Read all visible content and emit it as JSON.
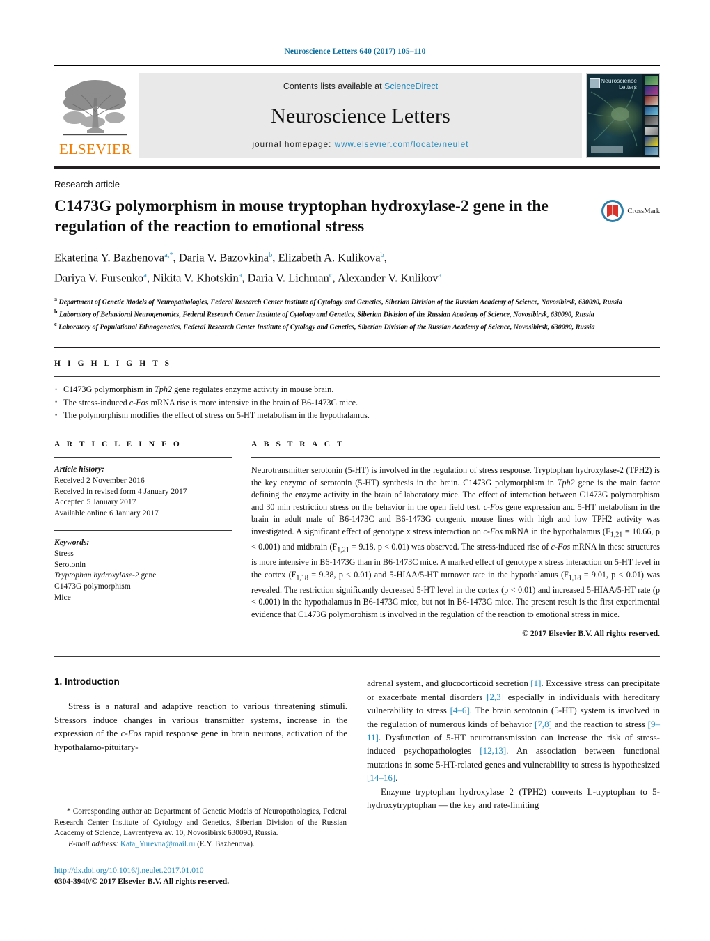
{
  "running_head": "Neuroscience Letters 640 (2017) 105–110",
  "banner": {
    "publisher": "ELSEVIER",
    "contents_prefix": "Contents lists available at ",
    "contents_link": "ScienceDirect",
    "journal_name": "Neuroscience Letters",
    "homepage_label": "journal homepage: ",
    "homepage_url": "www.elsevier.com/locate/neulet",
    "cover_title": "Neuroscience Letters"
  },
  "article": {
    "kicker": "Research article",
    "title": "C1473G polymorphism in mouse tryptophan hydroxylase-2 gene in the regulation of the reaction to emotional stress",
    "crossmark_label": "CrossMark",
    "authors_line1_parts": [
      {
        "name": "Ekaterina Y. Bazhenova",
        "sup": "a,",
        "star": "*"
      },
      {
        "name": "Daria V. Bazovkina",
        "sup": "b"
      },
      {
        "name": "Elizabeth A. Kulikova",
        "sup": "b"
      }
    ],
    "authors_line2_parts": [
      {
        "name": "Dariya V. Fursenko",
        "sup": "a"
      },
      {
        "name": "Nikita V. Khotskin",
        "sup": "a"
      },
      {
        "name": "Daria V. Lichman",
        "sup": "c"
      },
      {
        "name": "Alexander V. Kulikov",
        "sup": "a"
      }
    ],
    "affiliations": [
      {
        "mark": "a",
        "text": "Department of Genetic Models of Neuropathologies, Federal Research Center Institute of Cytology and Genetics, Siberian Division of the Russian Academy of Science, Novosibirsk, 630090, Russia"
      },
      {
        "mark": "b",
        "text": "Laboratory of Behavioral Neurogenomics, Federal Research Center Institute of Cytology and Genetics, Siberian Division of the Russian Academy of Science, Novosibirsk, 630090, Russia"
      },
      {
        "mark": "c",
        "text": "Laboratory of Populational Ethnogenetics, Federal Research Center Institute of Cytology and Genetics, Siberian Division of the Russian Academy of Science, Novosibirsk, 630090, Russia"
      }
    ]
  },
  "highlights": {
    "label": "H I G H L I G H T S",
    "items": [
      "C1473G polymorphism in Tph2 gene regulates enzyme activity in mouse brain.",
      "The stress-induced c-Fos mRNA rise is more intensive in the brain of B6-1473G mice.",
      "The polymorphism modifies the effect of stress on 5-HT metabolism in the hypothalamus."
    ]
  },
  "article_info": {
    "label": "A R T I C L E   I N F O",
    "history_heading": "Article history:",
    "history": [
      "Received 2 November 2016",
      "Received in revised form 4 January 2017",
      "Accepted 5 January 2017",
      "Available online 6 January 2017"
    ],
    "keywords_heading": "Keywords:",
    "keywords": [
      "Stress",
      "Serotonin",
      "Tryptophan hydroxylase-2 gene",
      "C1473G polymorphism",
      "Mice"
    ]
  },
  "abstract": {
    "label": "A B S T R A C T",
    "text": "Neurotransmitter serotonin (5-HT) is involved in the regulation of stress response. Tryptophan hydroxylase-2 (TPH2) is the key enzyme of serotonin (5-HT) synthesis in the brain. C1473G polymorphism in Tph2 gene is the main factor defining the enzyme activity in the brain of laboratory mice. The effect of interaction between C1473G polymorphism and 30 min restriction stress on the behavior in the open field test, c-Fos gene expression and 5-HT metabolism in the brain in adult male of B6-1473C and B6-1473G congenic mouse lines with high and low TPH2 activity was investigated. A significant effect of genotype x stress interaction on c-Fos mRNA in the hypothalamus (F1,21 = 10.66, p < 0.001) and midbrain (F1,21 = 9.18, p < 0.01) was observed. The stress-induced rise of c-Fos mRNA in these structures is more intensive in B6-1473G than in B6-1473C mice. A marked effect of genotype x stress interaction on 5-HT level in the cortex (F1,18 = 9.38, p < 0.01) and 5-HIAA/5-HT turnover rate in the hypothalamus (F1,18 = 9.01, p < 0.01) was revealed. The restriction significantly decreased 5-HT level in the cortex (p < 0.01) and increased 5-HIAA/5-HT rate (p < 0.001) in the hypothalamus in B6-1473C mice, but not in B6-1473G mice. The present result is the first experimental evidence that C1473G polymorphism is involved in the regulation of the reaction to emotional stress in mice.",
    "copyright": "© 2017 Elsevier B.V. All rights reserved."
  },
  "body": {
    "section_number_title": "1.  Introduction",
    "left_paragraph": "Stress is a natural and adaptive reaction to various threatening stimuli. Stressors induce changes in various transmitter systems, increase in the expression of the c-Fos rapid response gene in brain neurons, activation of the hypothalamo-pituitary-",
    "right_paragraph_1": "adrenal system, and glucocorticoid secretion [1]. Excessive stress can precipitate or exacerbate mental disorders [2,3] especially in individuals with hereditary vulnerability to stress [4–6]. The brain serotonin (5-HT) system is involved in the regulation of numerous kinds of behavior [7,8] and the reaction to stress [9–11]. Dysfunction of 5-HT neurotransmission can increase the risk of stress-induced psychopathologies [12,13]. An association between functional mutations in some 5-HT-related genes and vulnerability to stress is hypothesized [14–16].",
    "right_paragraph_2": "Enzyme tryptophan hydroxylase 2 (TPH2) converts L-tryptophan to 5-hydroxytryptophan — the key and rate-limiting"
  },
  "footnotes": {
    "corresponding_star": "*",
    "corresponding": "Corresponding author at: Department of Genetic Models of Neuropathologies, Federal Research Center Institute of Cytology and Genetics, Siberian Division of the Russian Academy of Science, Lavrentyeva av. 10, Novosibirsk 630090, Russia.",
    "email_label": "E-mail address:",
    "email": "Kata_Yurevna@mail.ru",
    "email_owner": "(E.Y. Bazhenova).",
    "doi": "http://dx.doi.org/10.1016/j.neulet.2017.01.010",
    "issn_line": "0304-3940/© 2017 Elsevier B.V. All rights reserved."
  },
  "colors": {
    "link": "#1f8ac0",
    "elsevier_orange": "#f07c00",
    "rule_dark": "#231f20"
  }
}
